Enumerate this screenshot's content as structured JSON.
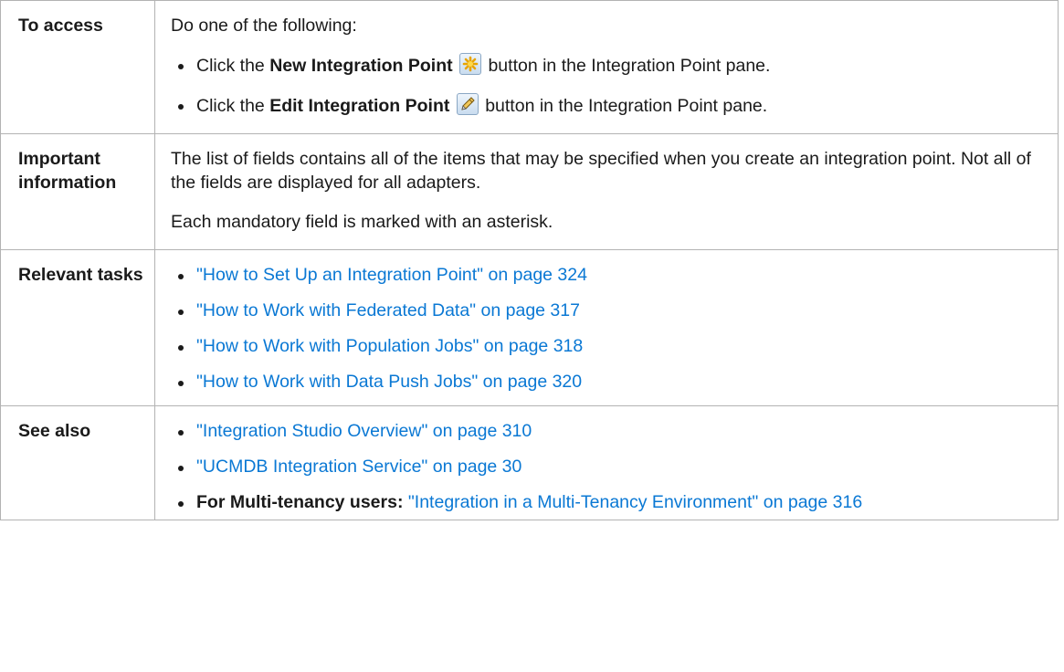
{
  "rows": {
    "access": {
      "label": "To access",
      "intro": "Do one of the following:",
      "items": [
        {
          "prefix": "Click the ",
          "bold": "New Integration Point",
          "icon": "new-integration-point-icon",
          "suffix": " button in the Integration Point pane."
        },
        {
          "prefix": "Click the ",
          "bold": "Edit Integration Point",
          "icon": "edit-integration-point-icon",
          "suffix": " button in the Integration Point pane."
        }
      ]
    },
    "important": {
      "label": "Important information",
      "para1": "The list of fields contains all of the items that may be specified when you create an integration point. Not all of the fields are displayed for all adapters.",
      "para2": "Each mandatory field is marked with an asterisk."
    },
    "tasks": {
      "label": "Relevant tasks",
      "links": [
        "\"How to Set Up an Integration Point\" on page 324",
        "\"How to Work with Federated Data\" on page 317",
        "\"How to Work with Population Jobs\" on page 318",
        "\"How to Work with Data Push Jobs\" on page 320"
      ]
    },
    "see_also": {
      "label": "See also",
      "links": [
        "\"Integration Studio Overview\" on page 310",
        "\"UCMDB Integration Service\" on page 30"
      ],
      "last_bold": "For Multi-tenancy users:",
      "last_link": "\"Integration in a Multi-Tenancy Environment\" on page 316"
    }
  },
  "colors": {
    "link": "#0a78d4",
    "border": "#b3b3b3",
    "text": "#1a1a1a"
  }
}
